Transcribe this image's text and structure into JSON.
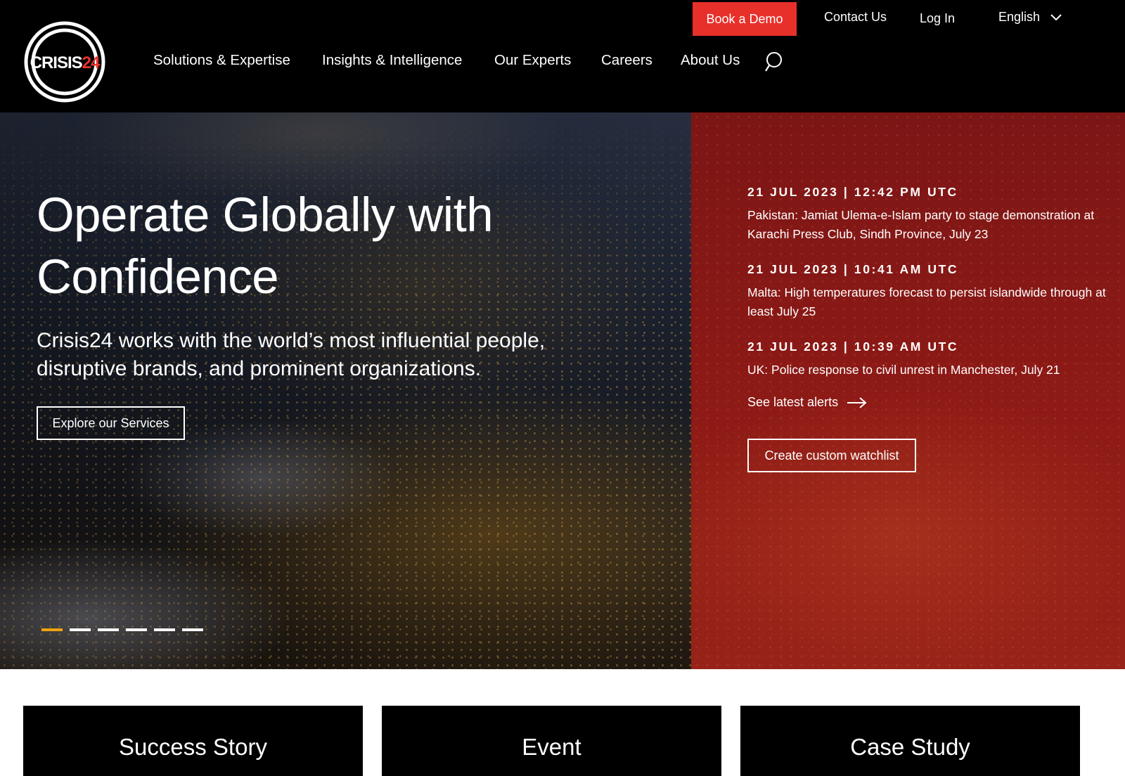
{
  "header": {
    "logo": {
      "text_main": "CRISIS",
      "text_accent": "24",
      "accent_color": "#e8302b"
    },
    "utility": {
      "book_demo": "Book a Demo",
      "contact": "Contact Us",
      "login": "Log In",
      "language": "English"
    },
    "nav": [
      "Solutions & Expertise",
      "Insights & Intelligence",
      "Our Experts",
      "Careers",
      "About Us"
    ],
    "search_icon": "search-icon"
  },
  "hero": {
    "title_line1": "Operate Globally with",
    "title_line2": "Confidence",
    "subtitle_line1": "Crisis24 works with the world’s most influential people,",
    "subtitle_line2": "disruptive brands, and prominent organizations.",
    "cta": "Explore our Services",
    "carousel": {
      "count": 6,
      "active": 1,
      "active_color": "#f2a30f"
    }
  },
  "alerts": {
    "items": [
      {
        "date": "21 JUL 2023 | 12:42 PM UTC",
        "text": "Pakistan: Jamiat Ulema-e-Islam party to stage demonstration at Karachi Press Club, Sindh Province, July 23"
      },
      {
        "date": "21 JUL 2023 | 10:41 AM UTC",
        "text": "Malta: High temperatures forecast to persist islandwide through at least July 25"
      },
      {
        "date": "21 JUL 2023 | 10:39 AM UTC",
        "text": "UK: Police response to civil unrest in Manchester, July 21"
      }
    ],
    "see_latest": "See latest alerts",
    "watchlist": "Create custom watchlist"
  },
  "cards": [
    "Success Story",
    "Event",
    "Case Study"
  ],
  "colors": {
    "brand_red": "#e8302b",
    "header_bg": "#000000",
    "panel_red": "#8c1a16"
  }
}
